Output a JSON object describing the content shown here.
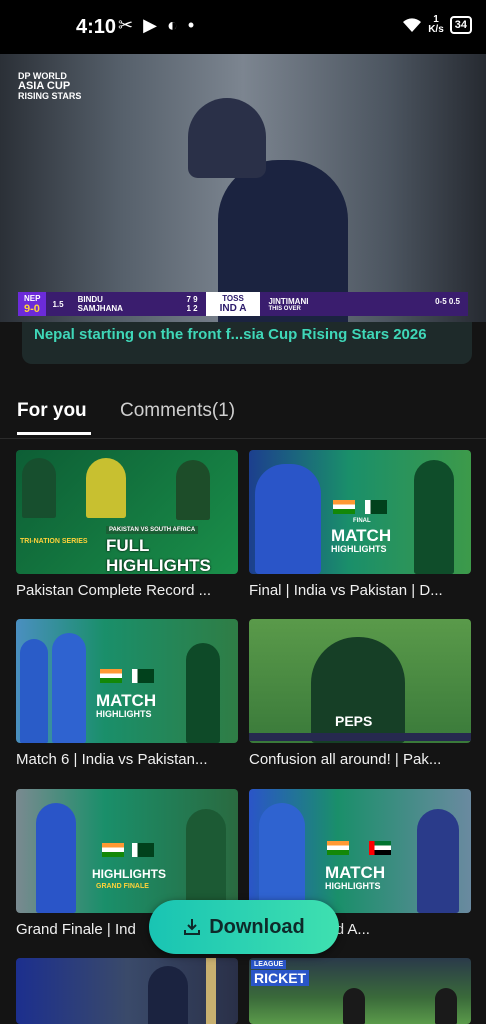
{
  "status_bar": {
    "time": "4:10",
    "net_speed_value": "1",
    "net_speed_unit": "K/s",
    "battery": "34"
  },
  "video": {
    "logo_line1": "DP WORLD",
    "logo_line2": "ASIA CUP",
    "logo_line3": "RISING STARS",
    "scoreboard": {
      "team": "NEP",
      "score": "9-0",
      "overs": "1.5",
      "batters": [
        {
          "name": "BINDU",
          "runs": "7",
          "balls": "9"
        },
        {
          "name": "SAMJHANA",
          "runs": "1",
          "balls": "2"
        }
      ],
      "toss_label": "TOSS",
      "toss_value": "IND A",
      "bowler": "JINTIMANI",
      "bowler_figs": "0-5",
      "bowler_overs": "0.5",
      "this_over": "THIS OVER"
    },
    "ticker": "Nepal starting on the front f...sia Cup Rising Stars 2026"
  },
  "tabs": [
    {
      "label": "For you",
      "active": true
    },
    {
      "label": "Comments(1)",
      "active": false
    }
  ],
  "cards": [
    {
      "title": "Pakistan Complete Record ...",
      "thumb_line1": "PAKISTAN VS SOUTH AFRICA",
      "thumb_line2": "FULL HIGHLIGHTS",
      "thumb_line3": "TRI-NATION SERIES"
    },
    {
      "title": "Final | India vs Pakistan | D...",
      "thumb_line1": "FINAL",
      "thumb_line2": "MATCH",
      "thumb_line3": "HIGHLIGHTS"
    },
    {
      "title": "Match 6 | India vs Pakistan...",
      "thumb_line1": "MATCH",
      "thumb_line2": "HIGHLIGHTS"
    },
    {
      "title": "Confusion all around! | Pak...",
      "thumb_line1": "PEPS"
    },
    {
      "title": "Grand Finale | Ind",
      "thumb_line1": "HIGHLIGHTS",
      "thumb_line2": "GRAND FINALE"
    },
    {
      "title": "ndia vs United A...",
      "thumb_line1": "MATCH",
      "thumb_line2": "HIGHLIGHTS"
    },
    {
      "title": "",
      "thumb_line1": ""
    },
    {
      "title": "",
      "thumb_line1": "LEAGUE",
      "thumb_line2": "RICKET"
    }
  ],
  "download_button": {
    "label": "Download"
  },
  "colors": {
    "accent": "#19c4b3",
    "ticker_text": "#3fd7b8",
    "background": "#141414"
  }
}
